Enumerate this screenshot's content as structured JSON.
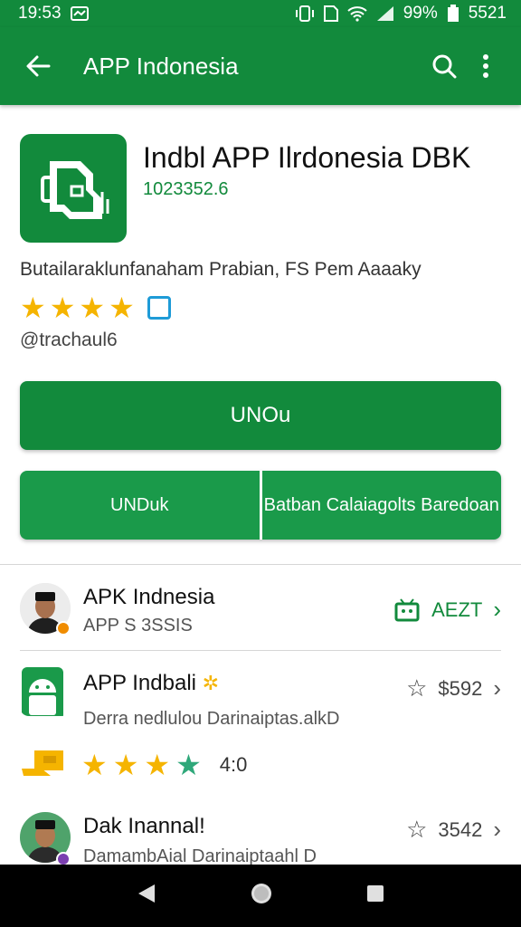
{
  "status_bar": {
    "time": "19:53",
    "battery_percent": "99%",
    "extra": "5521"
  },
  "app_bar": {
    "title": "APP Indonesia"
  },
  "app": {
    "name": "Indbl APP  Ilrdonesia DBK",
    "size": "1023352.6",
    "description": "Butailaraklunfanaham Prabian, FS Pem Aaaaky",
    "rating_stars": 4,
    "handle": "@trachaul6"
  },
  "buttons": {
    "install": "UNOu",
    "download": "UNDuk",
    "secondary": "Batban Calaiagolts Baredoan"
  },
  "list": [
    {
      "title": "APK Indnesia",
      "subtitle": "APP S 3SSIS",
      "right": "AEZT"
    },
    {
      "title": "APP Indbali",
      "subtitle": "Derra nedlulou Darinaiptas.alkD",
      "right": "$592",
      "rating": "4:0"
    },
    {
      "title": "Dak Inannal!",
      "subtitle": "DamambAial Darinaiptaahl D",
      "right": "3542"
    }
  ],
  "colors": {
    "brand": "#128a3c",
    "star": "#f5b400"
  }
}
